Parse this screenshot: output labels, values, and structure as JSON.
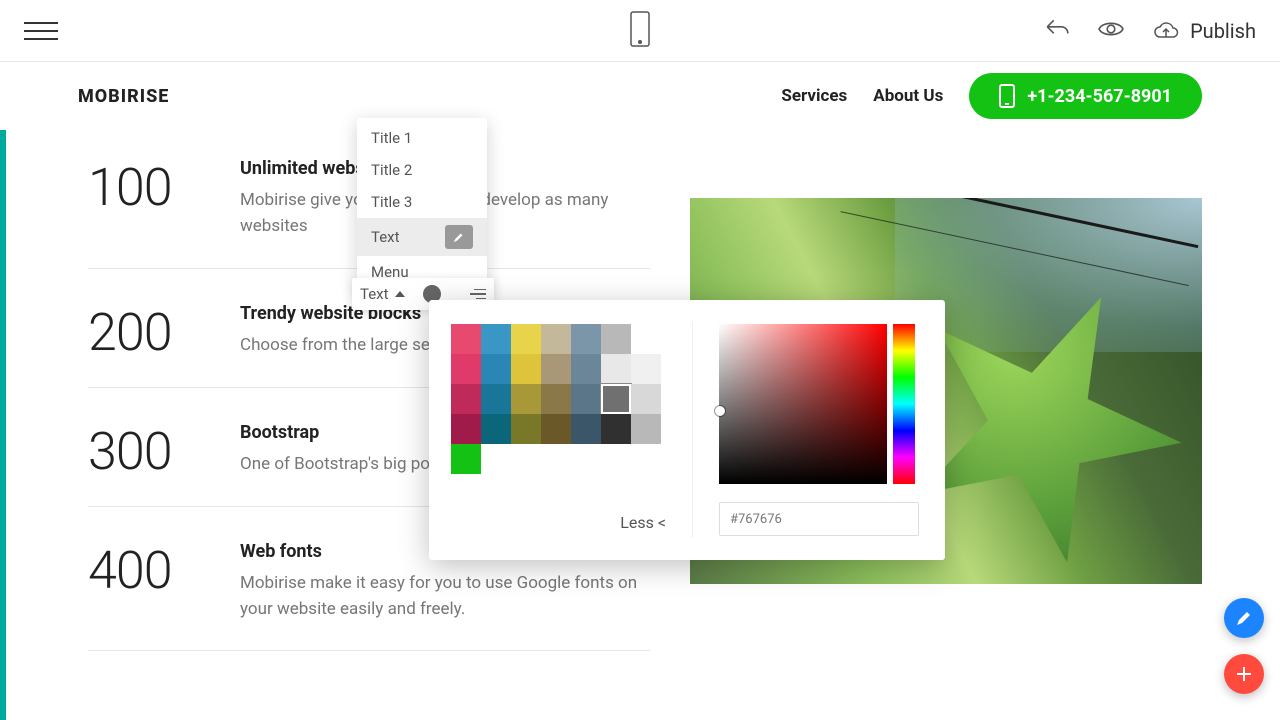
{
  "toolbar": {
    "publish_label": "Publish"
  },
  "header": {
    "logo": "MOBIRISE",
    "nav": [
      "Services",
      "About Us"
    ],
    "phone": "+1-234-567-8901"
  },
  "features": [
    {
      "num": "100",
      "title": "Unlimited websites",
      "desc": "Mobirise give you the license to develop as many websites"
    },
    {
      "num": "200",
      "title": "Trendy website blocks",
      "desc": "Choose from the large selection of made blocks."
    },
    {
      "num": "300",
      "title": "Bootstrap",
      "desc": "One of Bootstrap's big point"
    },
    {
      "num": "400",
      "title": "Web fonts",
      "desc": "Mobirise make it easy for you to use Google fonts on your website easily and freely."
    }
  ],
  "dropdown": {
    "items": [
      "Title 1",
      "Title 2",
      "Title 3",
      "Text",
      "Menu"
    ],
    "active": "Text"
  },
  "text_bar": {
    "label": "Text"
  },
  "color_picker": {
    "swatches": [
      [
        "#e84a6f",
        "#3a96c4",
        "#e8d44a",
        "#c4b89a",
        "#7a96a8",
        "#b8b8b8",
        "#ffffff"
      ],
      [
        "#e03a6a",
        "#2a86b4",
        "#ddc43a",
        "#a89878",
        "#6a8698",
        "#e8e8e8",
        "#f0f0f0"
      ],
      [
        "#c02a5a",
        "#1a7698",
        "#a89838",
        "#8a7848",
        "#5a7688",
        "#707070",
        "#d8d8d8"
      ],
      [
        "#a01a4a",
        "#0a6678",
        "#787828",
        "#6a5828",
        "#3a5668",
        "#303030",
        "#b8b8b8"
      ],
      [
        "#14c214"
      ]
    ],
    "less_label": "Less <",
    "hex": "#767676"
  }
}
